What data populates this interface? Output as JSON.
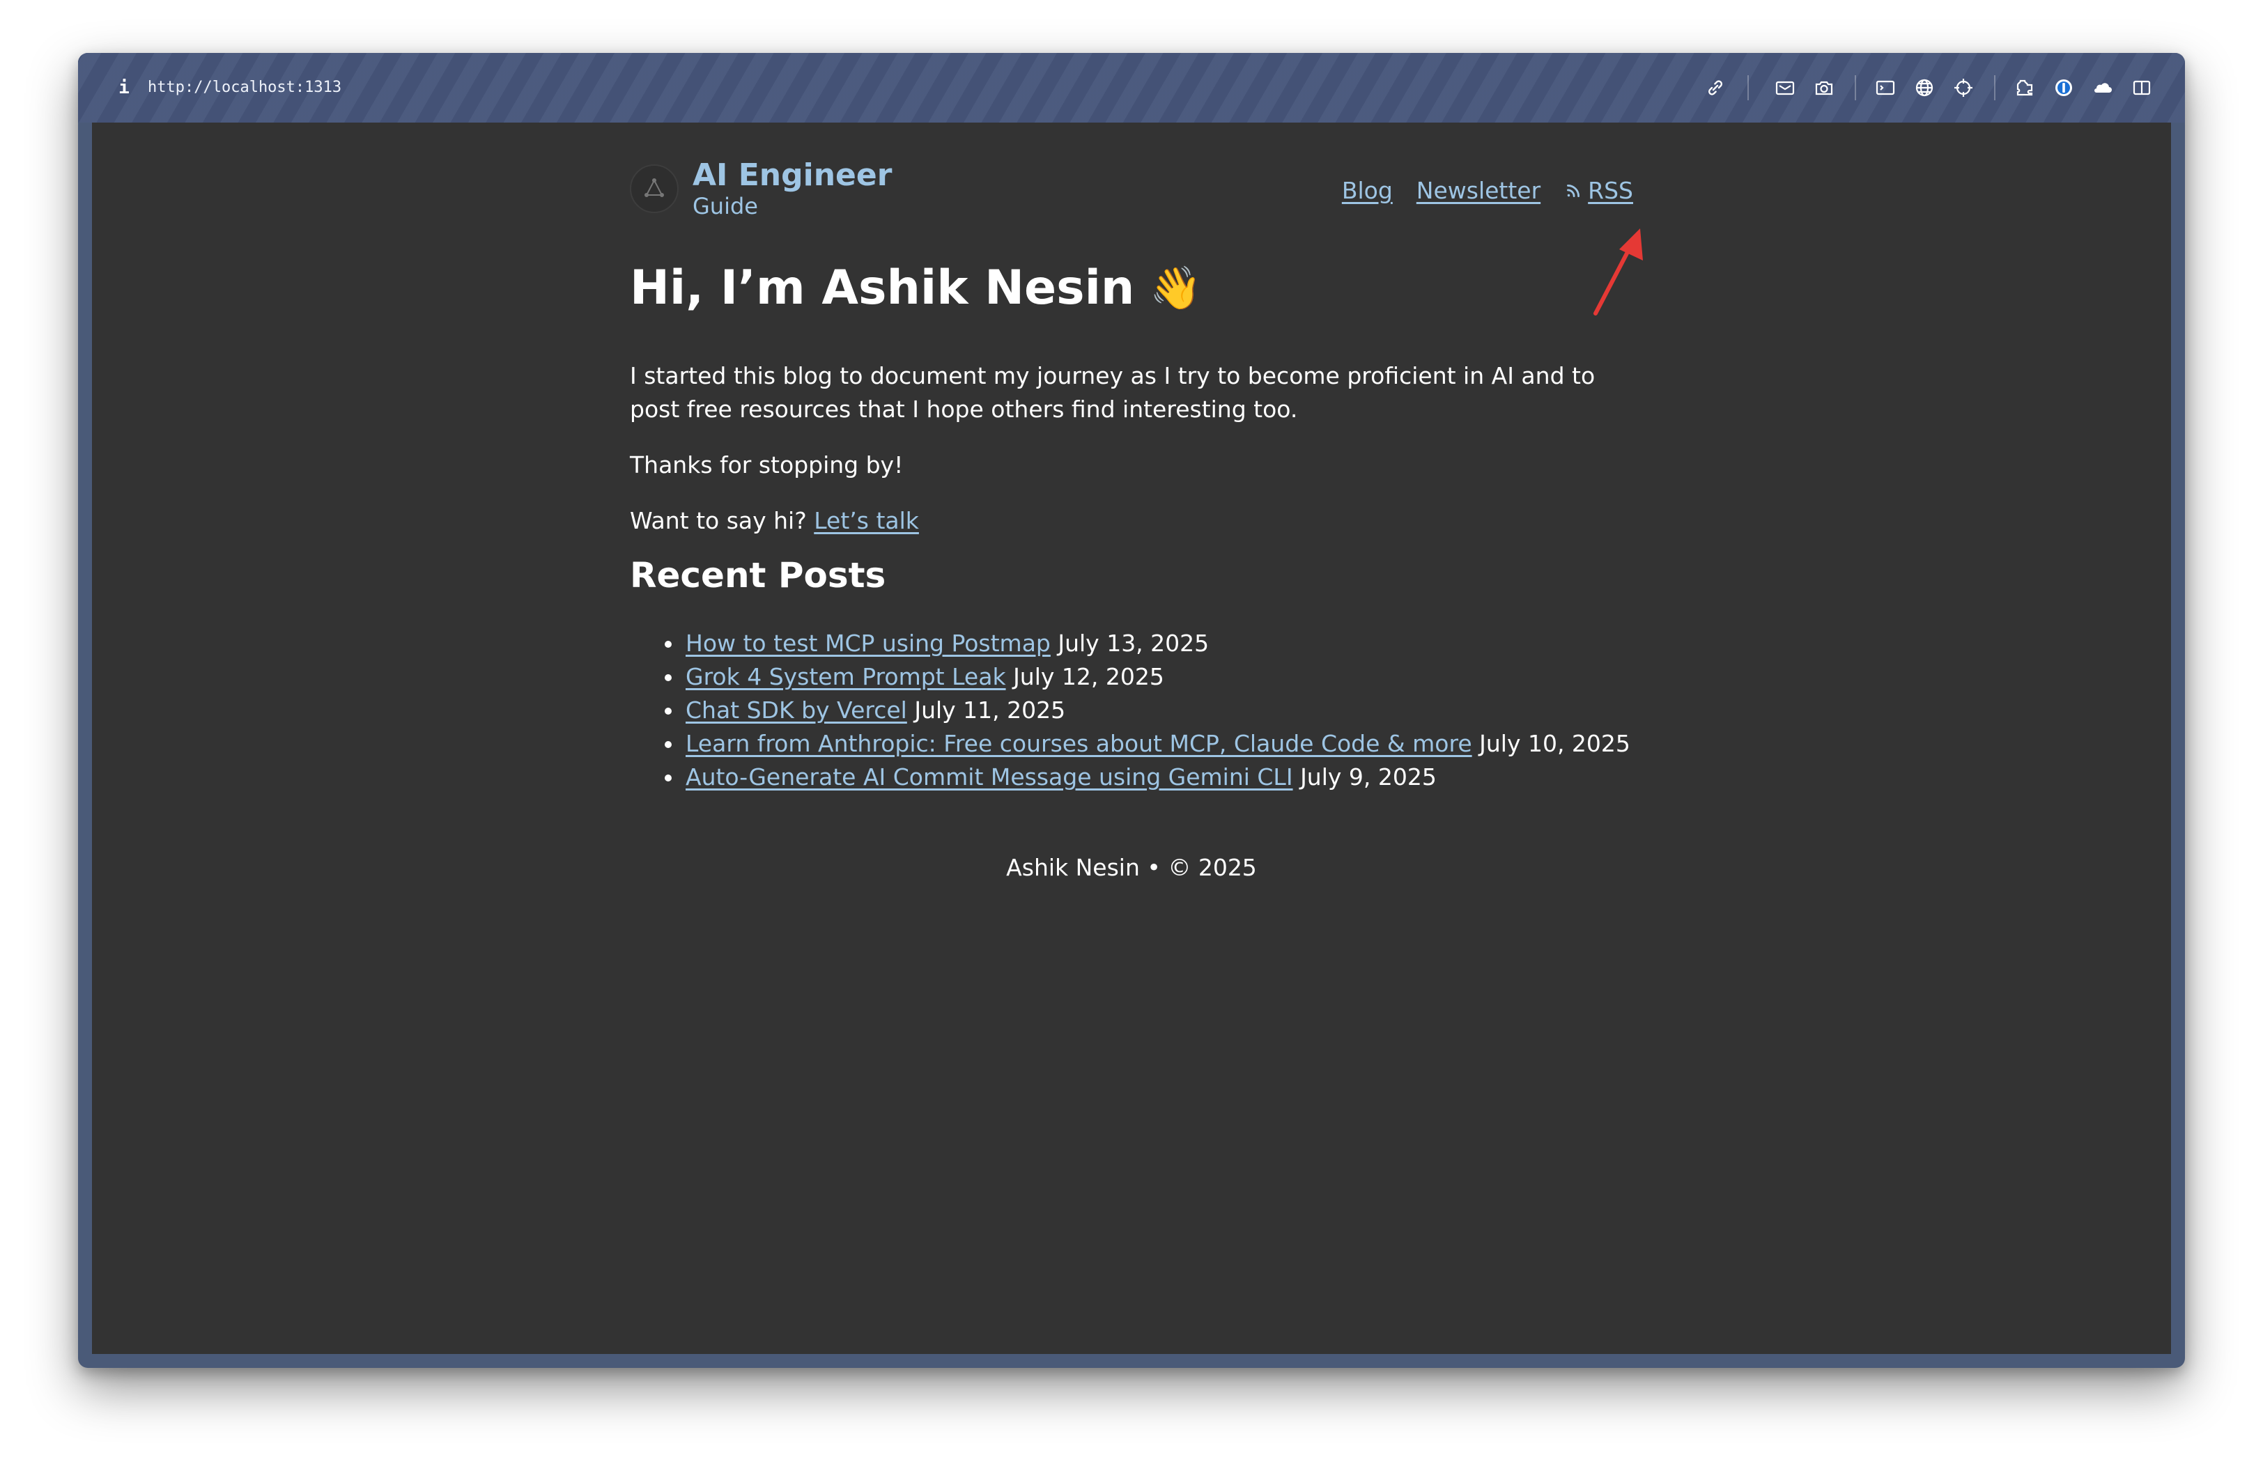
{
  "browser": {
    "info_label": "i",
    "url": "http://localhost:1313",
    "toolbar_icons": [
      "link-icon",
      "mail-icon",
      "camera-icon",
      "terminal-icon",
      "globe-icon",
      "crosshair-icon",
      "extension-icon",
      "password-manager-icon",
      "cloud-icon",
      "sidebar-icon"
    ]
  },
  "site": {
    "title": "AI Engineer",
    "subtitle": "Guide"
  },
  "nav": {
    "blog": "Blog",
    "newsletter": "Newsletter",
    "rss": "RSS"
  },
  "hero": {
    "heading": "Hi, I’m Ashik Nesin",
    "emoji": "👋"
  },
  "intro": {
    "p1": "I started this blog to document my journey as I try to become proficient in AI and to post free resources that I hope others find interesting too.",
    "p2": "Thanks for stopping by!",
    "p3_prefix": "Want to say hi?",
    "p3_link": "Let’s talk"
  },
  "recent": {
    "heading": "Recent Posts",
    "posts": [
      {
        "title": "How to test MCP using Postmap",
        "date": "July 13, 2025"
      },
      {
        "title": "Grok 4 System Prompt Leak",
        "date": "July 12, 2025"
      },
      {
        "title": "Chat SDK by Vercel",
        "date": "July 11, 2025"
      },
      {
        "title": "Learn from Anthropic: Free courses about MCP, Claude Code & more",
        "date": "July 10, 2025"
      },
      {
        "title": "Auto-Generate AI Commit Message using Gemini CLI",
        "date": "July 9, 2025"
      }
    ]
  },
  "footer": {
    "text": "Ashik Nesin • © 2025"
  },
  "colors": {
    "link": "#9ec5e4",
    "background": "#333333",
    "annotation_arrow": "#e53935"
  }
}
